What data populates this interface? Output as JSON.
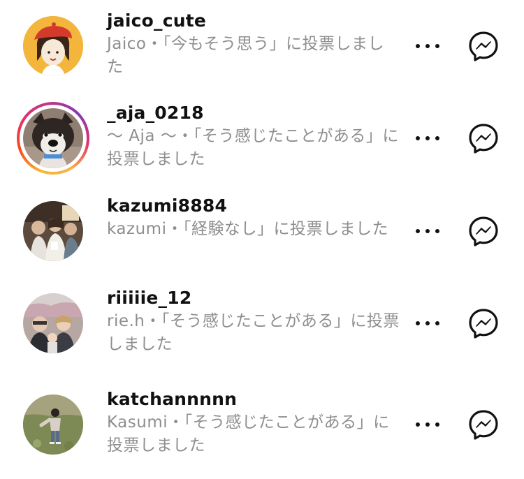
{
  "users": [
    {
      "username": "jaico_cute",
      "description": "Jaico・「今もそう思う」に投票しました",
      "avatar": "illustration-girl-red-beret",
      "story_ring": false
    },
    {
      "username": "_aja_0218",
      "description": "〜 Aja 〜・「そう感じたことがある」に投票しました",
      "avatar": "dog-photo",
      "story_ring": true
    },
    {
      "username": "kazumi8884",
      "description": "kazumi・「経験なし」に投票しました",
      "avatar": "group-photo",
      "story_ring": false
    },
    {
      "username": "riiiiie_12",
      "description": "rie.h・「そう感じたことがある」に投票しました",
      "avatar": "family-photo",
      "story_ring": false
    },
    {
      "username": "katchannnnn",
      "description": "Kasumi・「そう感じたことがある」に投票しました",
      "avatar": "child-outdoor-photo",
      "story_ring": false
    }
  ],
  "icons": {
    "more": "more-options-icon",
    "message": "messenger-icon"
  },
  "colors": {
    "username": "#111111",
    "secondary_text": "#8e8e8e",
    "story_ring_start": "#f7b733",
    "story_ring_end": "#c13584"
  }
}
